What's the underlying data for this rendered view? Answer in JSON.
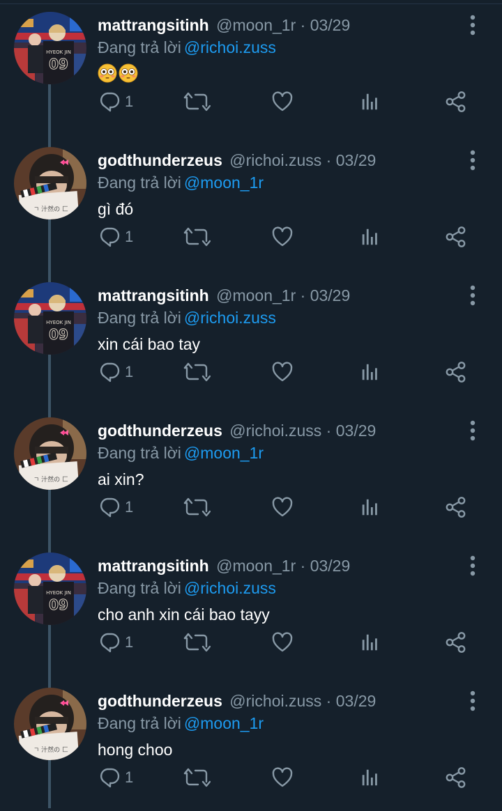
{
  "reply_prefix": "Đang trả lời",
  "separator": "·",
  "icons": {
    "reply": "reply-icon",
    "retweet": "retweet-icon",
    "like": "heart-icon",
    "stats": "stats-icon",
    "share": "share-icon",
    "more": "more-vertical-icon"
  },
  "colors": {
    "background": "#15202b",
    "secondary_text": "#8899a6",
    "mention": "#1d9bf0",
    "thread_line": "#3d5466"
  },
  "tweets": [
    {
      "display_name": "mattrangsitinh",
      "handle": "@moon_1r",
      "date": "03/29",
      "reply_to": "@richoi.zuss",
      "text": "",
      "emoji": [
        "flushed-face",
        "flushed-face"
      ],
      "reply_count": "1"
    },
    {
      "display_name": "godthunderzeus",
      "handle": "@richoi.zuss",
      "date": "03/29",
      "reply_to": "@moon_1r",
      "text": "gì đó",
      "reply_count": "1"
    },
    {
      "display_name": "mattrangsitinh",
      "handle": "@moon_1r",
      "date": "03/29",
      "reply_to": "@richoi.zuss",
      "text": "xin cái bao tay",
      "reply_count": "1"
    },
    {
      "display_name": "godthunderzeus",
      "handle": "@richoi.zuss",
      "date": "03/29",
      "reply_to": "@moon_1r",
      "text": "ai xin?",
      "reply_count": "1"
    },
    {
      "display_name": "mattrangsitinh",
      "handle": "@moon_1r",
      "date": "03/29",
      "reply_to": "@richoi.zuss",
      "text": "cho anh xin cái bao tayy",
      "reply_count": "1"
    },
    {
      "display_name": "godthunderzeus",
      "handle": "@richoi.zuss",
      "date": "03/29",
      "reply_to": "@moon_1r",
      "text": "hong choo",
      "reply_count": "1"
    }
  ]
}
